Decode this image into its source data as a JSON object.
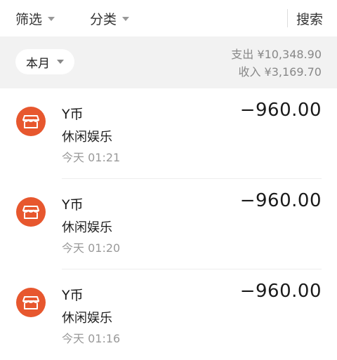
{
  "header": {
    "filter_label": "筛选",
    "category_label": "分类",
    "search_label": "搜索"
  },
  "summary": {
    "month_label": "本月",
    "expense_text": "支出 ¥10,348.90",
    "income_text": "收入 ¥3,169.70"
  },
  "transactions": [
    {
      "title": "Y币",
      "category": "休闲娱乐",
      "time": "今天  01:21",
      "amount": "−960.00",
      "icon": "shop-icon"
    },
    {
      "title": "Y币",
      "category": "休闲娱乐",
      "time": "今天  01:20",
      "amount": "−960.00",
      "icon": "shop-icon"
    },
    {
      "title": "Y币",
      "category": "休闲娱乐",
      "time": "今天  01:16",
      "amount": "−960.00",
      "icon": "shop-icon"
    }
  ],
  "colors": {
    "icon_bg": "#e7572e",
    "summary_bg": "#f2f2f2"
  }
}
